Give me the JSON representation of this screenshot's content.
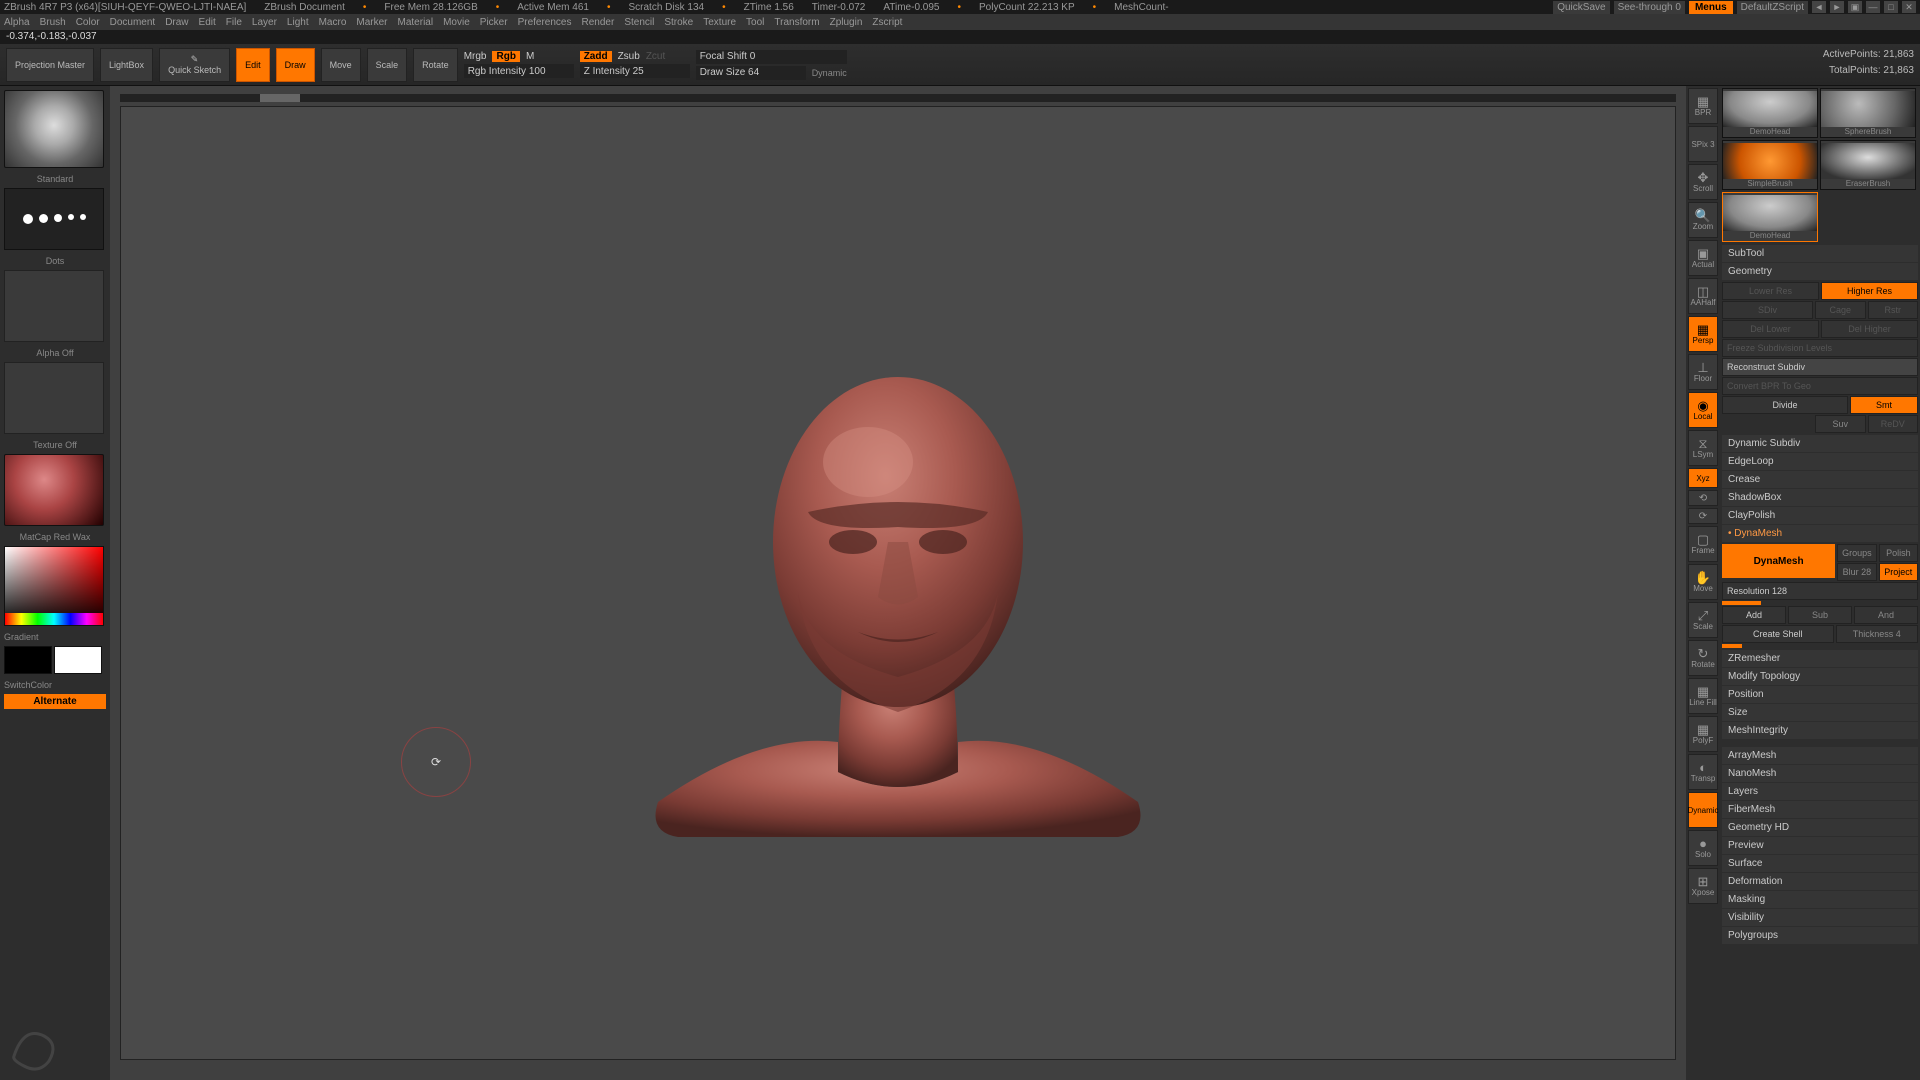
{
  "titlebar": {
    "app": "ZBrush 4R7 P3 (x64)[SIUH-QEYF-QWEO-LJTI-NAEA]",
    "doc": "ZBrush Document",
    "freemem": "Free Mem 28.126GB",
    "activemem": "Active Mem 461",
    "scratch": "Scratch Disk 134",
    "ztime": "ZTime 1.56",
    "timer": "Timer-0.072",
    "atime": "ATime-0.095",
    "polycount": "PolyCount 22.213 KP",
    "meshcount": "MeshCount-",
    "quicksave": "QuickSave",
    "seethrough": "See-through 0",
    "menus": "Menus",
    "script": "DefaultZScript"
  },
  "menubar": [
    "Alpha",
    "Brush",
    "Color",
    "Document",
    "Draw",
    "Edit",
    "File",
    "Layer",
    "Light",
    "Macro",
    "Marker",
    "Material",
    "Movie",
    "Picker",
    "Preferences",
    "Render",
    "Stencil",
    "Stroke",
    "Texture",
    "Tool",
    "Transform",
    "Zplugin",
    "Zscript"
  ],
  "status": "-0.374,-0.183,-0.037",
  "toolbar": {
    "projection": "Projection Master",
    "lightbox": "LightBox",
    "quicksketch": "Quick Sketch",
    "edit": "Edit",
    "draw": "Draw",
    "move": "Move",
    "scale": "Scale",
    "rotate": "Rotate",
    "mrgb": "Mrgb",
    "rgb": "Rgb",
    "m": "M",
    "rgbint": "Rgb Intensity 100",
    "zadd": "Zadd",
    "zsub": "Zsub",
    "zcut": "Zcut",
    "zint": "Z Intensity 25",
    "focal": "Focal Shift 0",
    "drawsize": "Draw Size 64",
    "dynamic": "Dynamic",
    "activepts": "ActivePoints: 21,863",
    "totalpts": "TotalPoints: 21,863"
  },
  "left": {
    "brush": "Standard",
    "stroke": "Dots",
    "alpha": "Alpha Off",
    "texture": "Texture Off",
    "material": "MatCap Red Wax",
    "gradient": "Gradient",
    "switchcolor": "SwitchColor",
    "alternate": "Alternate"
  },
  "iconcol": {
    "bpr": "BPR",
    "spix": "SPix 3",
    "scroll": "Scroll",
    "zoom": "Zoom",
    "actual": "Actual",
    "aahalf": "AAHalf",
    "persp": "Persp",
    "floor": "Floor",
    "local": "Local",
    "lsym": "LSym",
    "xyz": "Xyz",
    "frame": "Frame",
    "move": "Move",
    "scale": "Scale",
    "rotate": "Rotate",
    "linefill": "Line Fill",
    "polyf": "PolyF",
    "transp": "Transp",
    "dynamic": "Dynamic",
    "solo": "Solo",
    "xpose": "Xpose"
  },
  "tools": {
    "t1": "DemoHead",
    "t2": "SphereBrush",
    "t3": "SimpleBrush",
    "t4": "EraserBrush",
    "t5": "DemoHead"
  },
  "right": {
    "subtool": "SubTool",
    "geometry": "Geometry",
    "lowerres": "Lower Res",
    "higherres": "Higher Res",
    "sdiv": "SDiv",
    "cage": "Cage",
    "rstr": "Rstr",
    "dellower": "Del Lower",
    "delhigher": "Del Higher",
    "freeze": "Freeze Subdivision Levels",
    "reconstruct": "Reconstruct Subdiv",
    "convert": "Convert BPR To Geo",
    "divide": "Divide",
    "smt": "Smt",
    "suv": "Suv",
    "redv": "ReDV",
    "dynsubdiv": "Dynamic Subdiv",
    "edgeloop": "EdgeLoop",
    "crease": "Crease",
    "shadowbox": "ShadowBox",
    "claypolish": "ClayPolish",
    "dynamesh": "DynaMesh",
    "dynameshbtn": "DynaMesh",
    "groups": "Groups",
    "polish": "Polish",
    "blur": "Blur 28",
    "project": "Project",
    "resolution": "Resolution 128",
    "add": "Add",
    "sub": "Sub",
    "and": "And",
    "createshell": "Create Shell",
    "thickness": "Thickness 4",
    "zremesher": "ZRemesher",
    "modtopo": "Modify Topology",
    "position": "Position",
    "size": "Size",
    "meshint": "MeshIntegrity",
    "arraymesh": "ArrayMesh",
    "nanomesh": "NanoMesh",
    "layers": "Layers",
    "fibermesh": "FiberMesh",
    "geomhd": "Geometry HD",
    "preview": "Preview",
    "surface": "Surface",
    "deformation": "Deformation",
    "masking": "Masking",
    "visibility": "Visibility",
    "polygroups": "Polygroups"
  }
}
